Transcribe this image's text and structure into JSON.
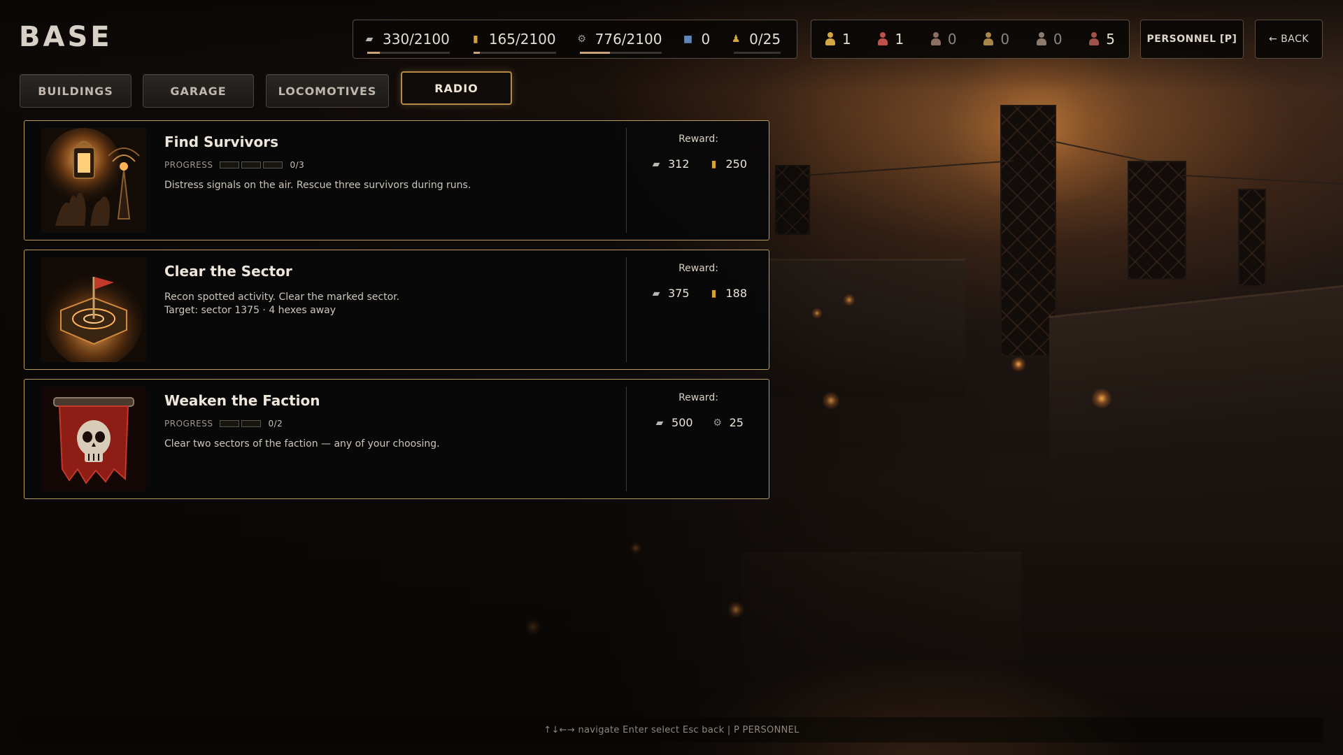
{
  "page": {
    "title": "BASE"
  },
  "resources": [
    {
      "icon": "metal-icon",
      "value": "330/2100",
      "fill": 0.157
    },
    {
      "icon": "fuel-icon",
      "value": "165/2100",
      "fill": 0.079
    },
    {
      "icon": "parts-icon",
      "value": "776/2100",
      "fill": 0.37
    },
    {
      "icon": "chip-icon",
      "value": "0"
    },
    {
      "icon": "medal-icon",
      "value": "0/25",
      "fill": 0
    }
  ],
  "personnel": [
    {
      "icon": "worker-icon",
      "value": "1",
      "color": "#d4a543"
    },
    {
      "icon": "medic-icon",
      "value": "1",
      "color": "#c0504a"
    },
    {
      "icon": "scout-icon",
      "value": "0",
      "color": "#8c6f63"
    },
    {
      "icon": "engineer-icon",
      "value": "0",
      "color": "#a98547"
    },
    {
      "icon": "soldier-icon",
      "value": "0",
      "color": "#8c7b6d"
    },
    {
      "icon": "officer-icon",
      "value": "5",
      "color": "#a0524a"
    }
  ],
  "header_buttons": {
    "personnel": "PERSONNEL [P]",
    "back": "← BACK"
  },
  "tabs": [
    {
      "label": "BUILDINGS",
      "active": false
    },
    {
      "label": "GARAGE",
      "active": false
    },
    {
      "label": "LOCOMOTIVES",
      "active": false
    },
    {
      "label": "RADIO",
      "active": true
    }
  ],
  "missions": [
    {
      "name": "Find Survivors",
      "progress_label": "PROGRESS",
      "progress_count": "0/3",
      "progress_total": 3,
      "desc": [
        "Distress signals on the air. Rescue three survivors during runs."
      ],
      "reward_label": "Reward:",
      "rewards": [
        {
          "icon": "metal-icon",
          "value": "312"
        },
        {
          "icon": "fuel-icon",
          "value": "250"
        }
      ],
      "art": "lantern-radio-icon"
    },
    {
      "name": "Clear the Sector",
      "desc": [
        "Recon spotted activity. Clear the marked sector.",
        "Target: sector 1375 · 4 hexes away"
      ],
      "reward_label": "Reward:",
      "rewards": [
        {
          "icon": "metal-icon",
          "value": "375"
        },
        {
          "icon": "fuel-icon",
          "value": "188"
        }
      ],
      "art": "sector-flag-icon"
    },
    {
      "name": "Weaken the Faction",
      "progress_label": "PROGRESS",
      "progress_count": "0/2",
      "progress_total": 2,
      "desc": [
        "Clear two sectors of the faction — any of your choosing."
      ],
      "reward_label": "Reward:",
      "rewards": [
        {
          "icon": "metal-icon",
          "value": "500"
        },
        {
          "icon": "parts-icon",
          "value": "25"
        }
      ],
      "art": "skull-banner-icon"
    }
  ],
  "footer": {
    "hint": "↑↓←→ navigate Enter select Esc back | P PERSONNEL"
  },
  "colors": {
    "accent": "#b48a4a",
    "card_border": "#6d6253",
    "bar_fill": "#c9a27a"
  }
}
